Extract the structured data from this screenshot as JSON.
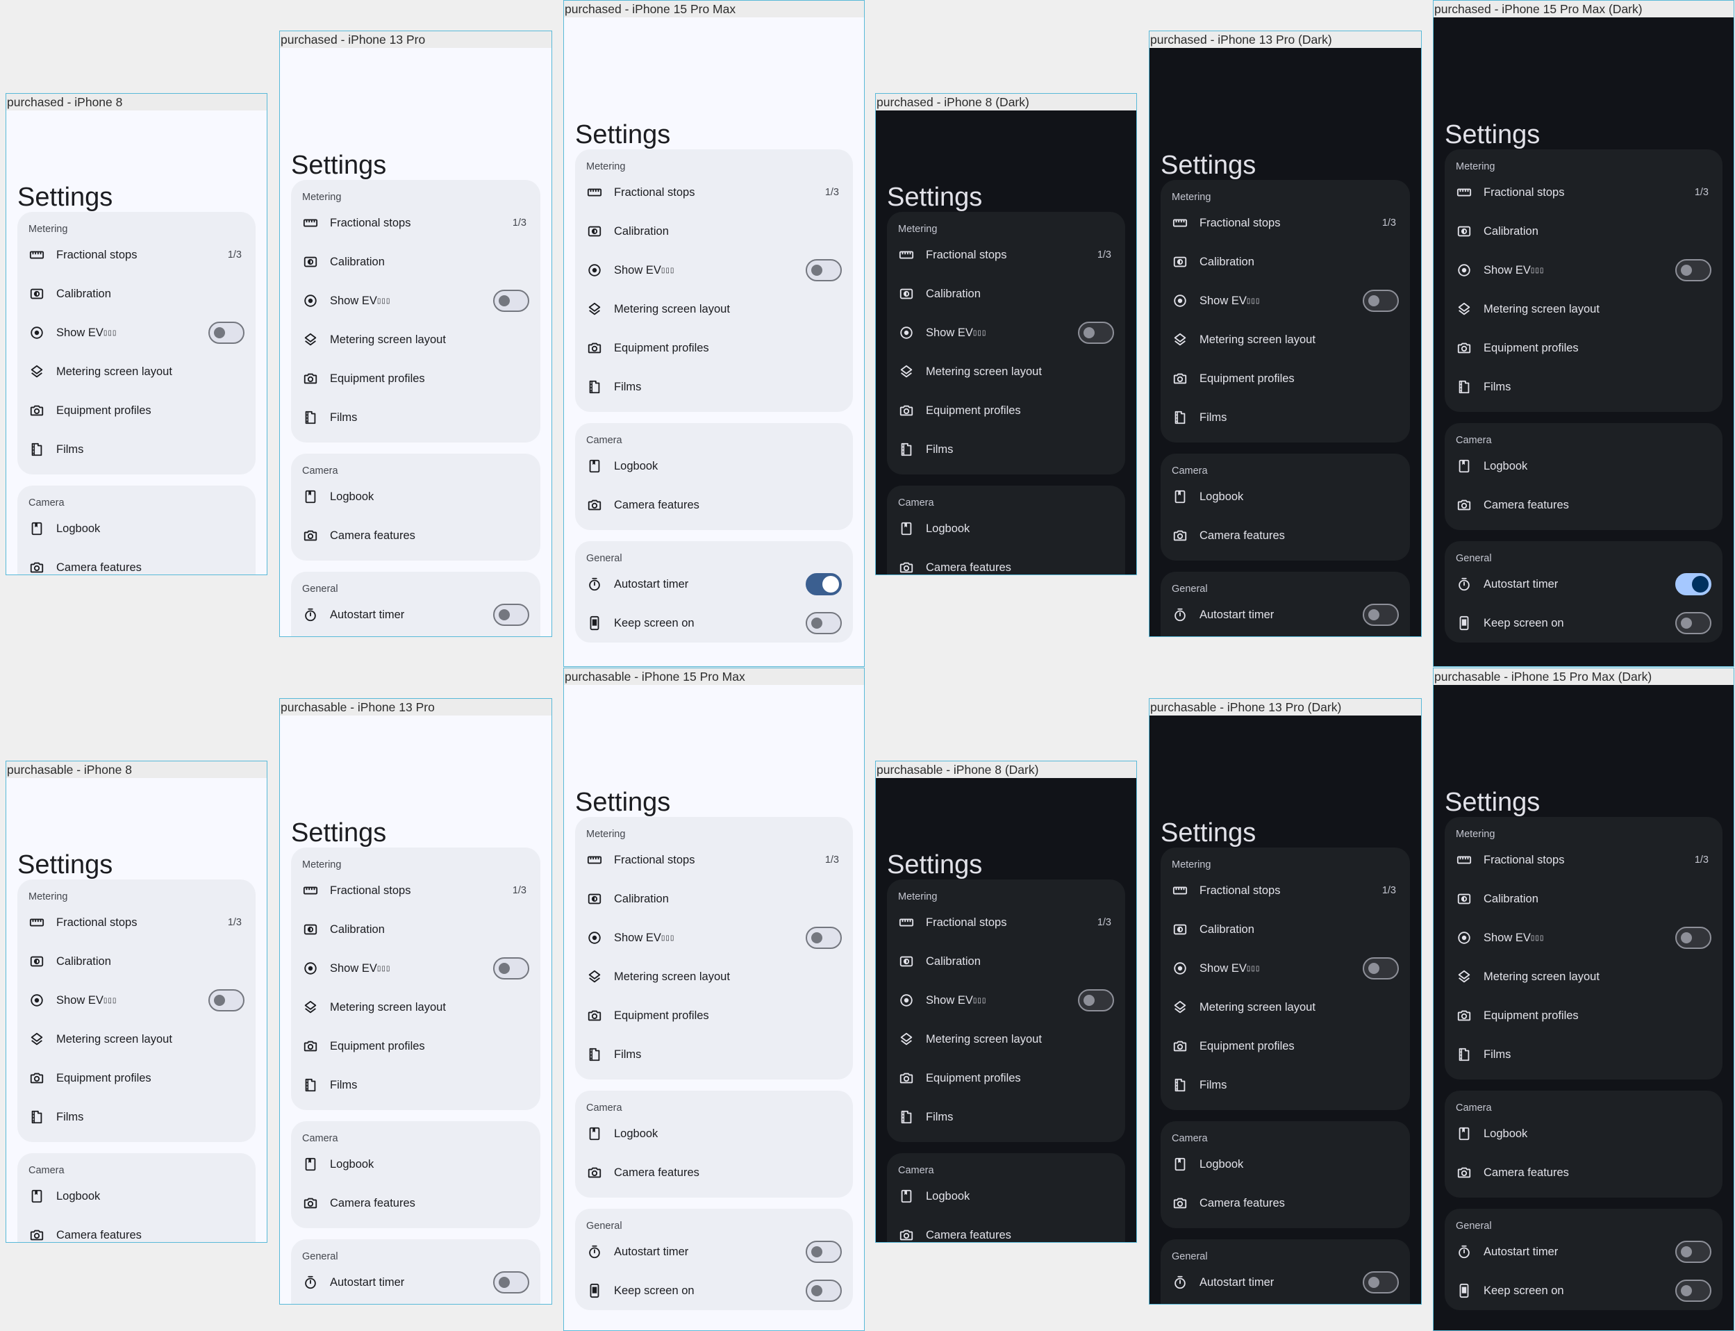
{
  "screen_title": "Settings",
  "sections": {
    "metering": "Metering",
    "camera": "Camera",
    "general": "General"
  },
  "items": {
    "fractional_stops": "Fractional stops",
    "fractional_stops_value": "1/3",
    "calibration": "Calibration",
    "show_ev": "Show EV",
    "show_ev_suffix": "▯▯▯",
    "metering_layout": "Metering screen layout",
    "equipment_profiles": "Equipment profiles",
    "films": "Films",
    "logbook": "Logbook",
    "camera_features": "Camera features",
    "autostart_timer": "Autostart timer",
    "keep_screen_on": "Keep screen on"
  },
  "devices": [
    {
      "label": "purchased - iPhone 8",
      "theme": "light",
      "autostart_on": false
    },
    {
      "label": "purchased - iPhone 13 Pro",
      "theme": "light",
      "autostart_on": false
    },
    {
      "label": "purchased - iPhone 15 Pro Max",
      "theme": "light",
      "autostart_on": true
    },
    {
      "label": "purchased - iPhone 8 (Dark)",
      "theme": "dark",
      "autostart_on": false
    },
    {
      "label": "purchased - iPhone 13 Pro (Dark)",
      "theme": "dark",
      "autostart_on": false
    },
    {
      "label": "purchased - iPhone 15 Pro Max (Dark)",
      "theme": "dark",
      "autostart_on": true
    },
    {
      "label": "purchasable - iPhone 8",
      "theme": "light",
      "autostart_on": false
    },
    {
      "label": "purchasable - iPhone 13 Pro",
      "theme": "light",
      "autostart_on": false
    },
    {
      "label": "purchasable - iPhone 15 Pro Max",
      "theme": "light",
      "autostart_on": false
    },
    {
      "label": "purchasable - iPhone 8 (Dark)",
      "theme": "dark",
      "autostart_on": false
    },
    {
      "label": "purchasable - iPhone 13 Pro (Dark)",
      "theme": "dark",
      "autostart_on": false
    },
    {
      "label": "purchasable - iPhone 15 Pro Max (Dark)",
      "theme": "dark",
      "autostart_on": false
    }
  ],
  "colors": {
    "frame_border": "#58b9d8",
    "light_bg": "#f8f9ff",
    "light_card": "#eceef4",
    "dark_bg": "#111318",
    "dark_card": "#1d2024",
    "switch_on_light": "#3b5f90",
    "switch_on_dark": "#a5c8ff"
  }
}
